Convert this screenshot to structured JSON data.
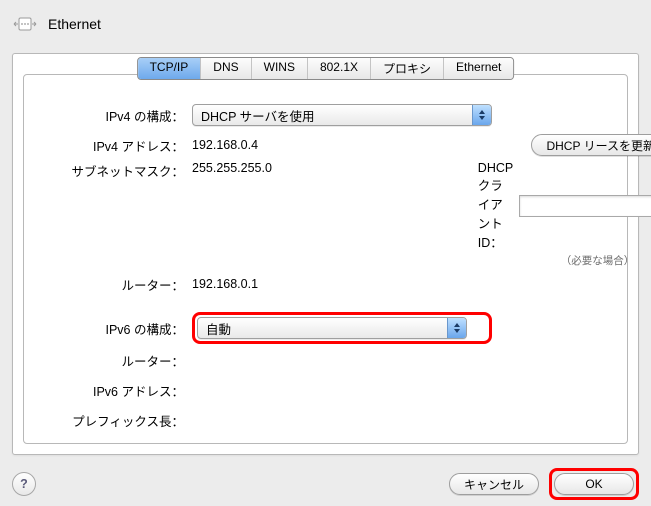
{
  "header": {
    "title": "Ethernet"
  },
  "tabs": {
    "tcpip": "TCP/IP",
    "dns": "DNS",
    "wins": "WINS",
    "x8021": "802.1X",
    "proxy": "プロキシ",
    "ethernet": "Ethernet",
    "active": "tcpip"
  },
  "labels": {
    "ipv4_config": "IPv4 の構成：",
    "ipv4_address": "IPv4 アドレス：",
    "subnet_mask": "サブネットマスク：",
    "router": "ルーター：",
    "ipv6_config": "IPv6 の構成：",
    "ipv6_router": "ルーター：",
    "ipv6_address": "IPv6 アドレス：",
    "prefix_len": "プレフィックス長：",
    "dhcp_client_id": "DHCP クライアント ID："
  },
  "values": {
    "ipv4_config": "DHCP サーバを使用",
    "ipv4_address": "192.168.0.4",
    "subnet_mask": "255.255.255.0",
    "router": "192.168.0.1",
    "ipv6_config": "自動",
    "dhcp_client_id": ""
  },
  "buttons": {
    "renew_lease": "DHCP リースを更新",
    "cancel": "キャンセル",
    "ok": "OK"
  },
  "hints": {
    "if_required": "（必要な場合）"
  }
}
